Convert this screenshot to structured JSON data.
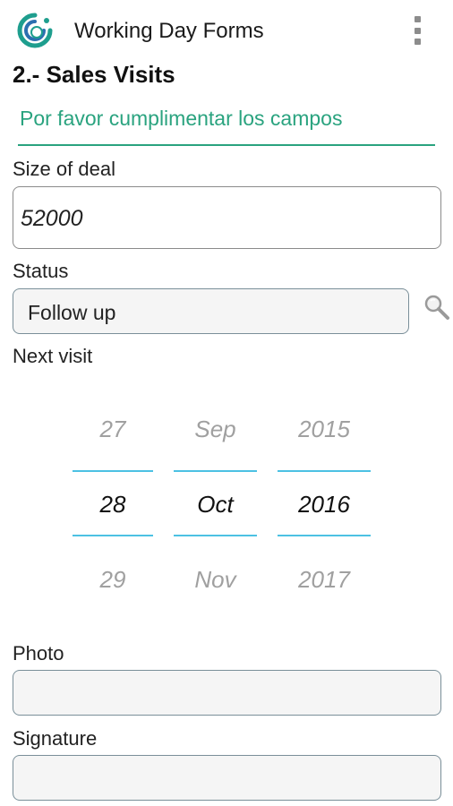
{
  "app": {
    "title": "Working Day Forms",
    "icon": "app-logo-icon",
    "menu_icon": "overflow-menu-icon"
  },
  "form": {
    "section_title": "2.- Sales Visits",
    "hint": "Por favor cumplimentar los campos",
    "size_of_deal": {
      "label": "Size of deal",
      "value": "52000"
    },
    "status": {
      "label": "Status",
      "value": "Follow up",
      "search_icon": "magnifier-icon"
    },
    "next_visit": {
      "label": "Next visit",
      "days": [
        "27",
        "28",
        "29"
      ],
      "months": [
        "Sep",
        "Oct",
        "Nov"
      ],
      "years": [
        "2015",
        "2016",
        "2017"
      ],
      "selected": {
        "day": "28",
        "month": "Oct",
        "year": "2016"
      }
    },
    "photo": {
      "label": "Photo",
      "value": ""
    },
    "signature": {
      "label": "Signature",
      "value": ""
    }
  },
  "colors": {
    "accent_green": "#2aa37f",
    "picker_line": "#4cc1e3",
    "field_border": "#7a8f99"
  }
}
